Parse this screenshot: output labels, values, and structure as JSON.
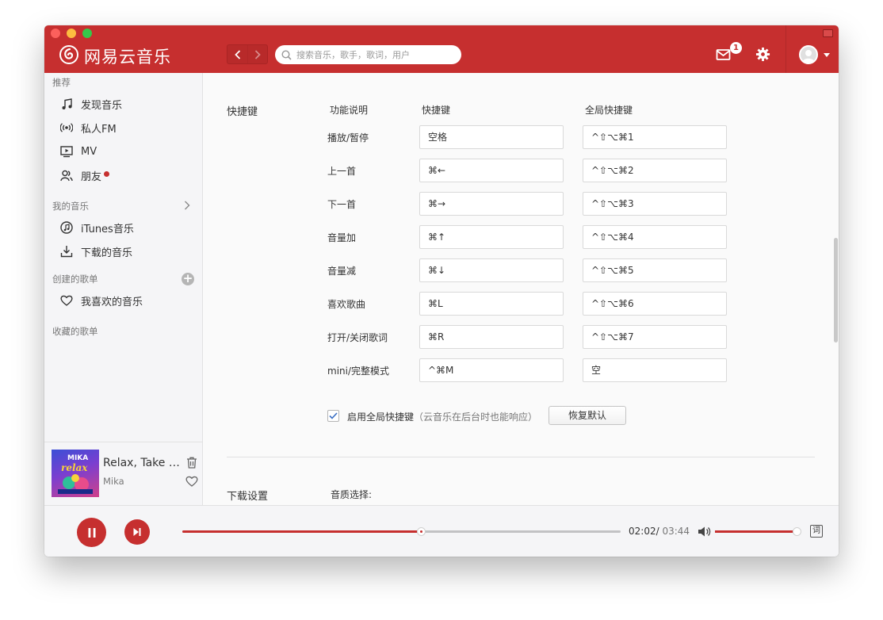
{
  "app": {
    "title": "网易云音乐",
    "brand_color": "#c62f2f"
  },
  "header": {
    "search_placeholder": "搜索音乐，歌手，歌词，用户",
    "mail_badge": "1"
  },
  "sidebar": {
    "section_recommend": "推荐",
    "recommend_items": [
      {
        "label": "发现音乐",
        "icon": "music-note-icon"
      },
      {
        "label": "私人FM",
        "icon": "radio-icon"
      },
      {
        "label": "MV",
        "icon": "tv-icon"
      },
      {
        "label": "朋友",
        "icon": "friends-icon"
      }
    ],
    "section_my_music": "我的音乐",
    "my_music_items": [
      {
        "label": "iTunes音乐",
        "icon": "itunes-icon"
      },
      {
        "label": "下载的音乐",
        "icon": "download-icon"
      }
    ],
    "section_created": "创建的歌单",
    "created_items": [
      {
        "label": "我喜欢的音乐",
        "icon": "heart-icon"
      }
    ],
    "section_collected": "收藏的歌单",
    "now_playing": {
      "title": "Relax, Take It Easy",
      "artist": "Mika",
      "album_text_1": "MIKA",
      "album_text_2": "relax"
    }
  },
  "settings": {
    "shortcuts_section": "快捷键",
    "columns": {
      "function": "功能说明",
      "shortcut": "快捷键",
      "global": "全局快捷键"
    },
    "rows": [
      {
        "label": "播放/暂停",
        "shortcut": "空格",
        "global": "^⇧⌥⌘1"
      },
      {
        "label": "上一首",
        "shortcut": "⌘←",
        "global": "^⇧⌥⌘2"
      },
      {
        "label": "下一首",
        "shortcut": "⌘→",
        "global": "^⇧⌥⌘3"
      },
      {
        "label": "音量加",
        "shortcut": "⌘↑",
        "global": "^⇧⌥⌘4"
      },
      {
        "label": "音量减",
        "shortcut": "⌘↓",
        "global": "^⇧⌥⌘5"
      },
      {
        "label": "喜欢歌曲",
        "shortcut": "⌘L",
        "global": "^⇧⌥⌘6"
      },
      {
        "label": "打开/关闭歌词",
        "shortcut": "⌘R",
        "global": "^⇧⌥⌘7"
      },
      {
        "label": "mini/完整模式",
        "shortcut": "^⌘M",
        "global": "空"
      }
    ],
    "enable_global_label": "启用全局快捷键",
    "enable_global_note": "（云音乐在后台时也能响应）",
    "enable_global_checked": true,
    "restore_button": "恢复默认",
    "download_section": "下载设置",
    "quality_label": "音质选择:"
  },
  "player": {
    "current_time": "02:02/",
    "total_time": " 03:44",
    "progress_fraction": 0.545,
    "volume_fraction": 1.0,
    "lyric_label": "词"
  }
}
